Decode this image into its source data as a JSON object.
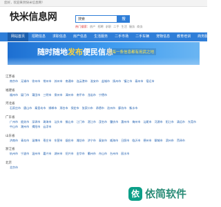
{
  "topbar": {
    "text": "您好，欢迎来到快米信息网！"
  },
  "header": {
    "logo": "快米信息网",
    "search": {
      "value": "搜索",
      "button": "搜索"
    },
    "hot_label": "热门搜索：",
    "hot_items": [
      "房产",
      "招聘",
      "求职",
      "二手",
      "生活",
      "服务",
      "商务"
    ]
  },
  "nav": {
    "items": [
      {
        "label": "网站首页",
        "active": true
      },
      {
        "label": "招聘信息",
        "active": false
      },
      {
        "label": "求职信息",
        "active": false
      },
      {
        "label": "房产信息",
        "active": false
      },
      {
        "label": "生活服务",
        "active": false
      },
      {
        "label": "二手市场",
        "active": false
      },
      {
        "label": "二手车辆",
        "active": false
      },
      {
        "label": "宠物信息",
        "active": false
      },
      {
        "label": "教育培训",
        "active": false
      },
      {
        "label": "商务服务",
        "active": false
      }
    ]
  },
  "banner": {
    "title_white": "随时随地",
    "title_yellow": "发布",
    "title_tail": "便民信息",
    "slogan": "让每一条信息都有用武之地"
  },
  "regions": [
    {
      "name": "江苏省",
      "cities": [
        "南京市",
        "无锡市",
        "徐州市",
        "常州市",
        "苏州市",
        "南通市",
        "连云港市",
        "淮安市",
        "盐城市",
        "扬州市",
        "镇江市",
        "泰州市",
        "宿迁市"
      ]
    },
    {
      "name": "福建省",
      "cities": [
        "福州市",
        "厦门市",
        "莆田市",
        "三明市",
        "泉州市",
        "漳州市",
        "南平市",
        "龙岩市",
        "宁德市"
      ]
    },
    {
      "name": "河北省",
      "cities": [
        "石家庄市",
        "唐山市",
        "秦皇岛市",
        "邯郸市",
        "邢台市",
        "保定市",
        "张家口市",
        "承德市",
        "沧州市",
        "廊坊市",
        "衡水市"
      ]
    },
    {
      "name": "广东省",
      "cities": [
        "广州市",
        "韶关市",
        "深圳市",
        "珠海市",
        "汕头市",
        "佛山市",
        "江门市",
        "湛江市",
        "茂名市",
        "肇庆市",
        "惠州市",
        "梅州市",
        "汕尾市",
        "河源市",
        "阳江市",
        "清远市",
        "东莞市",
        "中山市",
        "潮州市",
        "揭阳市",
        "云浮市"
      ]
    },
    {
      "name": "山东省",
      "cities": [
        "济南市",
        "青岛市",
        "淄博市",
        "枣庄市",
        "东营市",
        "烟台市",
        "潍坊市",
        "济宁市",
        "泰安市",
        "威海市",
        "日照市",
        "临沂市",
        "德州市",
        "聊城市",
        "滨州市",
        "菏泽市"
      ]
    },
    {
      "name": "浙江省",
      "cities": [
        "杭州市",
        "宁波市",
        "温州市",
        "嘉兴市",
        "湖州市",
        "绍兴市",
        "金华市",
        "衢州市",
        "舟山市",
        "台州市",
        "丽水市"
      ]
    },
    {
      "name": "北京",
      "cities": [
        "北京市"
      ]
    }
  ],
  "watermark": {
    "mark": "依",
    "text": "依简软件"
  },
  "colors": {
    "accent": "#2f7ed8",
    "nav_active": "#1c5fae",
    "link": "#1f5fb0"
  }
}
